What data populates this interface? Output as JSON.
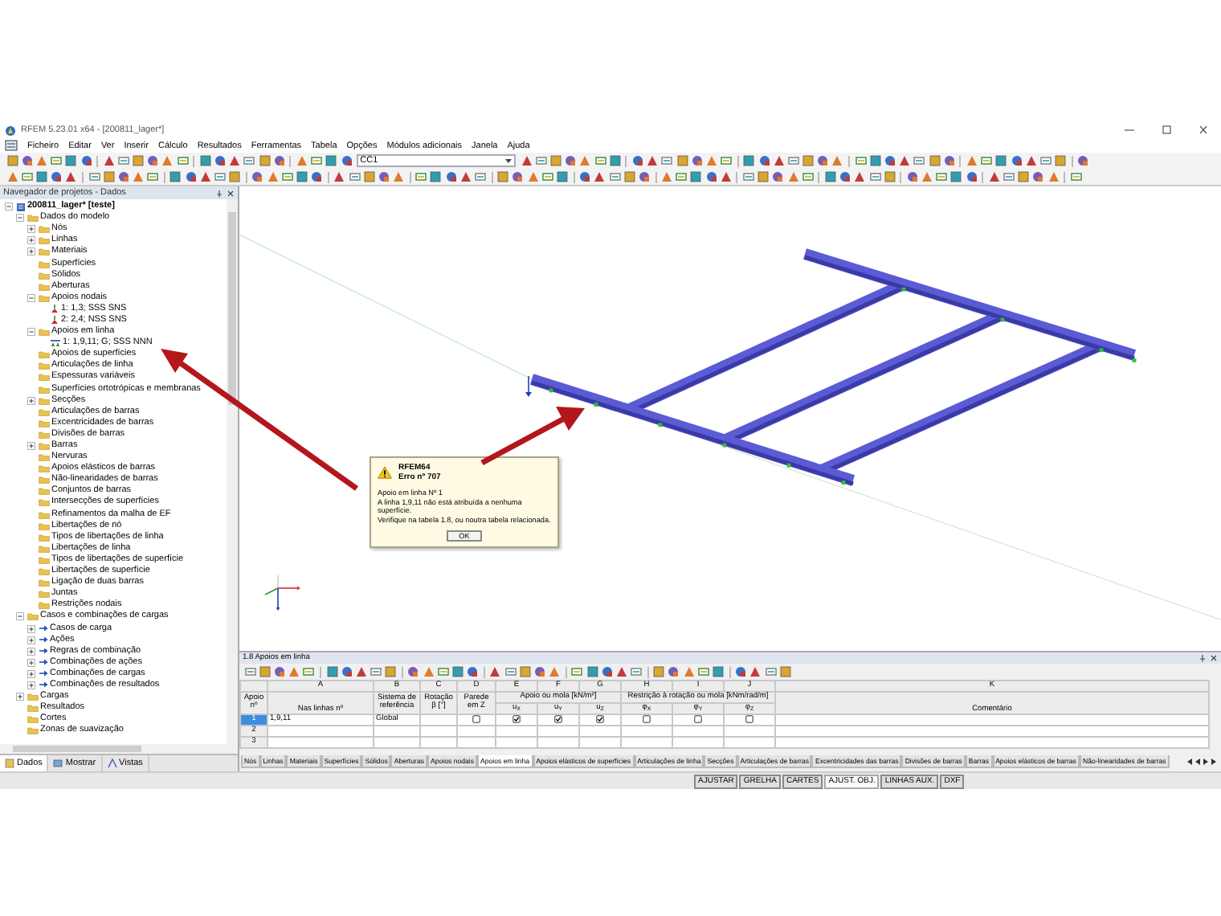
{
  "window": {
    "title": "RFEM 5.23.01 x64 - [200811_lager*]"
  },
  "menu": [
    "Ficheiro",
    "Editar",
    "Ver",
    "Inserir",
    "Cálculo",
    "Resultados",
    "Ferramentas",
    "Tabela",
    "Opções",
    "Módulos adicionais",
    "Janela",
    "Ajuda"
  ],
  "toolbar": {
    "load_case": "CC1"
  },
  "navigator": {
    "title": "Navegador de projetos - Dados",
    "tree": [
      {
        "label": "200811_lager* [teste]",
        "kind": "project",
        "expanded": true,
        "children": [
          {
            "label": "Dados do modelo",
            "kind": "folder",
            "expanded": true,
            "children": [
              {
                "label": "Nós",
                "kind": "folder",
                "expanded": false
              },
              {
                "label": "Linhas",
                "kind": "folder",
                "expanded": false
              },
              {
                "label": "Materiais",
                "kind": "folder",
                "expanded": false
              },
              {
                "label": "Superfícies",
                "kind": "folder"
              },
              {
                "label": "Sólidos",
                "kind": "folder"
              },
              {
                "label": "Aberturas",
                "kind": "folder"
              },
              {
                "label": "Apoios nodais",
                "kind": "folder",
                "expanded": true,
                "children": [
                  {
                    "label": "1: 1,3; SSS SNS",
                    "kind": "support"
                  },
                  {
                    "label": "2: 2,4; NSS SNS",
                    "kind": "support"
                  }
                ]
              },
              {
                "label": "Apoios em linha",
                "kind": "folder",
                "expanded": true,
                "children": [
                  {
                    "label": "1: 1,9,11; G; SSS NNN",
                    "kind": "line-support"
                  }
                ]
              },
              {
                "label": "Apoios de superfícies",
                "kind": "folder"
              },
              {
                "label": "Articulações de linha",
                "kind": "folder"
              },
              {
                "label": "Espessuras variáveis",
                "kind": "folder"
              },
              {
                "label": "Superfícies ortotrópicas e membranas",
                "kind": "folder"
              },
              {
                "label": "Secções",
                "kind": "folder",
                "expanded": false
              },
              {
                "label": "Articulações de barras",
                "kind": "folder"
              },
              {
                "label": "Excentricidades de barras",
                "kind": "folder"
              },
              {
                "label": "Divisões de barras",
                "kind": "folder"
              },
              {
                "label": "Barras",
                "kind": "folder",
                "expanded": false
              },
              {
                "label": "Nervuras",
                "kind": "folder"
              },
              {
                "label": "Apoios elásticos de barras",
                "kind": "folder"
              },
              {
                "label": "Não-linearidades de barras",
                "kind": "folder"
              },
              {
                "label": "Conjuntos de barras",
                "kind": "folder"
              },
              {
                "label": "Intersecções de superfícies",
                "kind": "folder"
              },
              {
                "label": "Refinamentos da malha de EF",
                "kind": "folder"
              },
              {
                "label": "Libertações de nó",
                "kind": "folder"
              },
              {
                "label": "Tipos de libertações de linha",
                "kind": "folder"
              },
              {
                "label": "Libertações de linha",
                "kind": "folder"
              },
              {
                "label": "Tipos de libertações de superfície",
                "kind": "folder"
              },
              {
                "label": "Libertações de superfície",
                "kind": "folder"
              },
              {
                "label": "Ligação de duas barras",
                "kind": "folder"
              },
              {
                "label": "Juntas",
                "kind": "folder"
              },
              {
                "label": "Restrições nodais",
                "kind": "folder"
              }
            ]
          },
          {
            "label": "Casos e combinações de cargas",
            "kind": "folder",
            "expanded": true,
            "children": [
              {
                "label": "Casos de carga",
                "kind": "load",
                "expanded": false
              },
              {
                "label": "Ações",
                "kind": "load",
                "expanded": false
              },
              {
                "label": "Regras de combinação",
                "kind": "load",
                "expanded": false
              },
              {
                "label": "Combinações de ações",
                "kind": "load",
                "expanded": false
              },
              {
                "label": "Combinações de cargas",
                "kind": "load",
                "expanded": false
              },
              {
                "label": "Combinações de resultados",
                "kind": "load",
                "expanded": false
              }
            ]
          },
          {
            "label": "Cargas",
            "kind": "folder",
            "expanded": false
          },
          {
            "label": "Resultados",
            "kind": "folder"
          },
          {
            "label": "Cortes",
            "kind": "folder"
          },
          {
            "label": "Zonas de suavização",
            "kind": "folder"
          }
        ]
      }
    ],
    "tabs": [
      {
        "label": "Dados",
        "selected": true
      },
      {
        "label": "Mostrar",
        "selected": false
      },
      {
        "label": "Vistas",
        "selected": false
      }
    ]
  },
  "viewport": {
    "dialog": {
      "title": "RFEM64",
      "code": "Erro nº 707",
      "lines": [
        "Apoio em linha Nº 1",
        "A linha 1,9,11 não está atribuída a nenhuma superfície.",
        "Verifique na tabela 1.8, ou noutra tabela relacionada."
      ],
      "button": "OK"
    }
  },
  "table": {
    "title": "1.8 Apoios em linha",
    "row_header": "Apoio nº",
    "columns": [
      {
        "kind": "single",
        "letter": "A",
        "label": "Nas linhas nº"
      },
      {
        "kind": "single",
        "letter": "B",
        "label": "Sistema de referência"
      },
      {
        "kind": "single",
        "letter": "C",
        "label": "Rotação β [°]"
      },
      {
        "kind": "single",
        "letter": "D",
        "label": "Parede em Z"
      },
      {
        "kind": "group",
        "label": "Apoio ou mola [kN/m²]",
        "columns": [
          {
            "letter": "E",
            "label": "u$_{X}$"
          },
          {
            "letter": "F",
            "label": "u$_{Y}$"
          },
          {
            "letter": "G",
            "label": "u$_{Z}$"
          }
        ]
      },
      {
        "kind": "group",
        "label": "Restrição à rotação ou mola [kNm/rad/m]",
        "columns": [
          {
            "letter": "H",
            "label": "φ$_{X}$"
          },
          {
            "letter": "I",
            "label": "φ$_{Y}$"
          },
          {
            "letter": "J",
            "label": "φ$_{Z}$"
          }
        ]
      },
      {
        "kind": "single",
        "letter": "K",
        "label": "Comentário"
      }
    ],
    "rows": [
      {
        "number": "1",
        "selected": true,
        "cells": {
          "A": "1,9,11",
          "B": "Global"
        },
        "checks": {
          "D": false,
          "E": true,
          "F": true,
          "G": true,
          "H": false,
          "I": false,
          "J": false
        }
      },
      {
        "number": "2",
        "selected": false
      },
      {
        "number": "3",
        "selected": false
      }
    ]
  },
  "sheet_tabs": [
    {
      "label": "Nós",
      "selected": false
    },
    {
      "label": "Linhas",
      "selected": false
    },
    {
      "label": "Materiais",
      "selected": false
    },
    {
      "label": "Superfícies",
      "selected": false
    },
    {
      "label": "Sólidos",
      "selected": false
    },
    {
      "label": "Aberturas",
      "selected": false
    },
    {
      "label": "Apoios nodais",
      "selected": false
    },
    {
      "label": "Apoios em linha",
      "selected": true
    },
    {
      "label": "Apoios elásticos de superfícies",
      "selected": false
    },
    {
      "label": "Articulações de linha",
      "selected": false
    },
    {
      "label": "Secções",
      "selected": false
    },
    {
      "label": "Articulações de barras",
      "selected": false
    },
    {
      "label": "Excentricidades das barras",
      "selected": false
    },
    {
      "label": "Divisões de barras",
      "selected": false
    },
    {
      "label": "Barras",
      "selected": false
    },
    {
      "label": "Apoios elásticos de barras",
      "selected": false
    },
    {
      "label": "Não-linearidades de barras",
      "selected": false
    }
  ],
  "status_bar": [
    {
      "label": "AJUSTAR",
      "on": false
    },
    {
      "label": "GRELHA",
      "on": false
    },
    {
      "label": "CARTES",
      "on": false
    },
    {
      "label": "AJUST. OBJ.",
      "on": true
    },
    {
      "label": "LINHAS AUX.",
      "on": false
    },
    {
      "label": "DXF",
      "on": false
    }
  ]
}
